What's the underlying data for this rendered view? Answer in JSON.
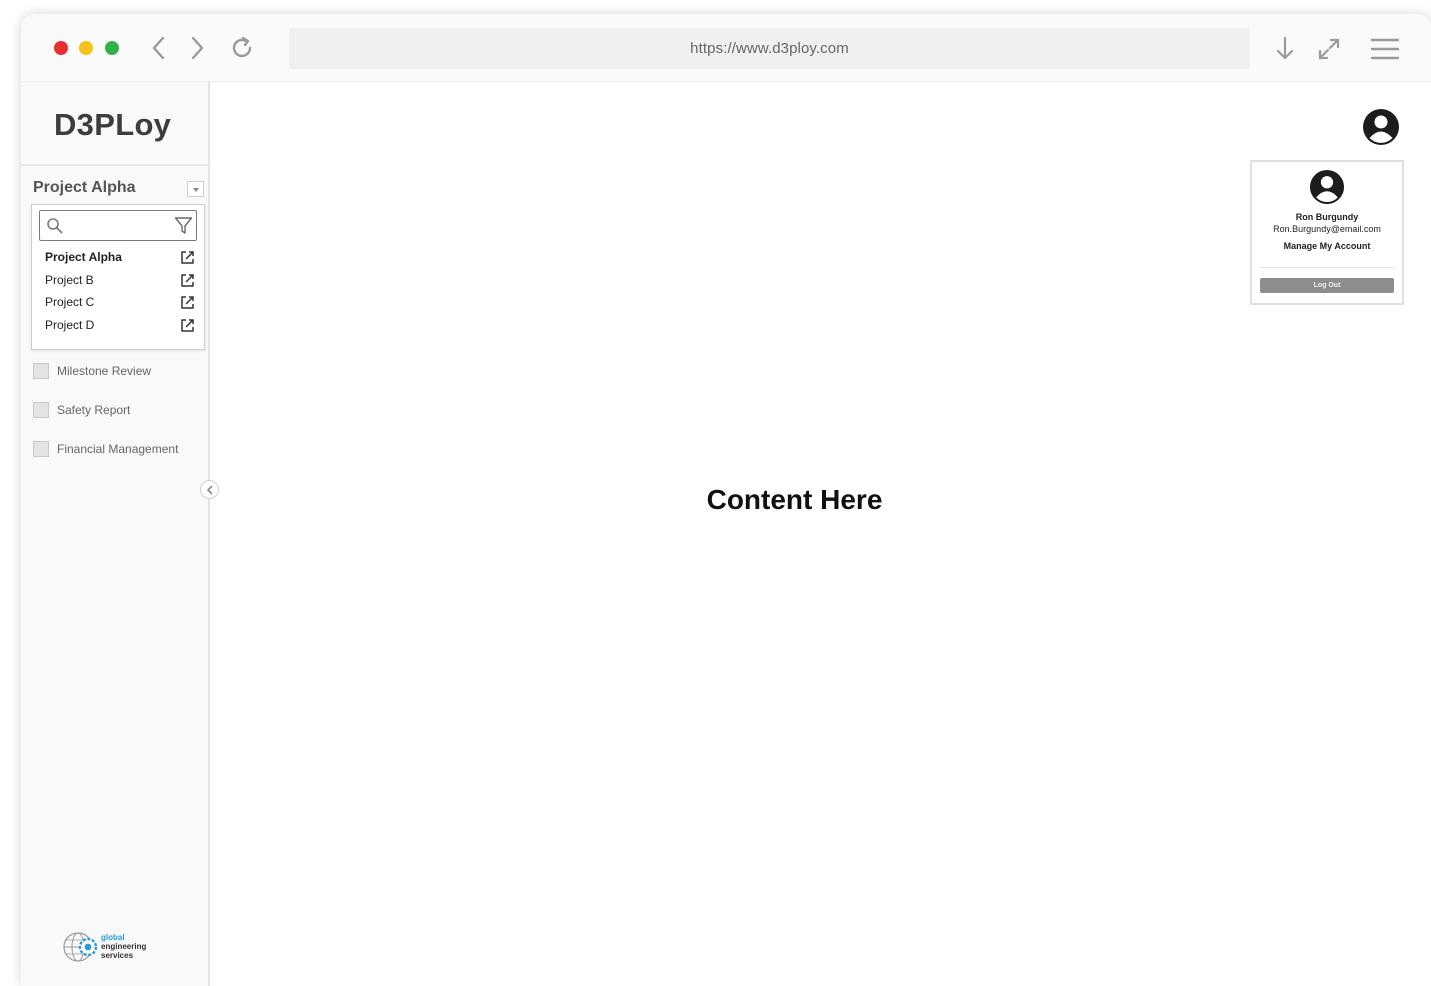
{
  "browser": {
    "url": "https://www.d3ploy.com",
    "icons": [
      "back-icon",
      "forward-icon",
      "reload-icon",
      "download-icon",
      "fullscreen-icon",
      "menu-icon"
    ]
  },
  "sidebar": {
    "logo": "D3PLoy",
    "selected_project": "Project Alpha",
    "search": {
      "value": "",
      "placeholder": ""
    },
    "projects": [
      {
        "name": "Project Alpha",
        "active": true
      },
      {
        "name": "Project B",
        "active": false
      },
      {
        "name": "Project C",
        "active": false
      },
      {
        "name": "Project D",
        "active": false
      }
    ],
    "nav_items": [
      {
        "label": "Milestone Review"
      },
      {
        "label": "Safety Report"
      },
      {
        "label": "Financial Management"
      }
    ],
    "company": {
      "line1": "global",
      "line2": "engineering",
      "line3": "services"
    }
  },
  "main": {
    "placeholder": "Content Here"
  },
  "account": {
    "name": "Ron Burgundy",
    "email": "Ron.Burgundy@email.com",
    "manage_label": "Manage My Account",
    "logout_label": "Log Out"
  },
  "colors": {
    "traffic_red": "#e8312d",
    "traffic_yellow": "#f6c218",
    "traffic_green": "#2fb344",
    "logout_button": "#8d8d8d",
    "logo_blue": "#2a9bd7"
  }
}
